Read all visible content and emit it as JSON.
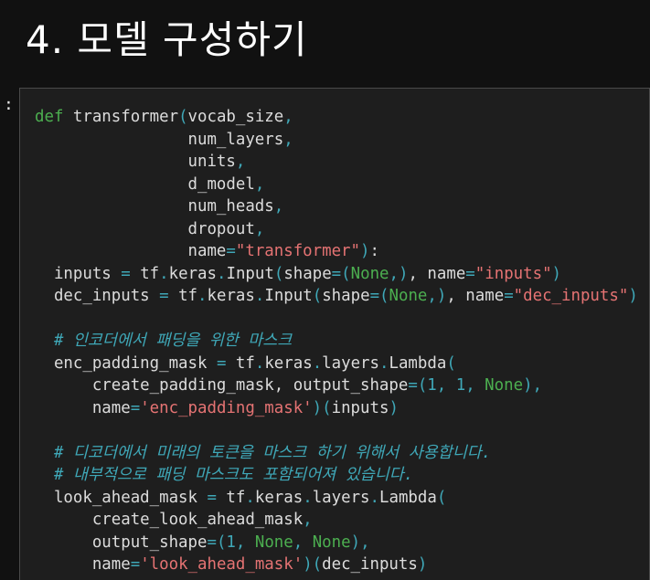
{
  "section": {
    "title": "4. 모델 구성하기"
  },
  "cell": {
    "prompt": ":",
    "lines": [
      [
        [
          "kw",
          "def"
        ],
        [
          "plain",
          " transformer"
        ],
        [
          "op",
          "("
        ],
        [
          "plain",
          "vocab_size"
        ],
        [
          "op",
          ","
        ]
      ],
      [
        [
          "plain",
          "                num_layers"
        ],
        [
          "op",
          ","
        ]
      ],
      [
        [
          "plain",
          "                units"
        ],
        [
          "op",
          ","
        ]
      ],
      [
        [
          "plain",
          "                d_model"
        ],
        [
          "op",
          ","
        ]
      ],
      [
        [
          "plain",
          "                num_heads"
        ],
        [
          "op",
          ","
        ]
      ],
      [
        [
          "plain",
          "                dropout"
        ],
        [
          "op",
          ","
        ]
      ],
      [
        [
          "plain",
          "                name"
        ],
        [
          "op",
          "="
        ],
        [
          "str",
          "\"transformer\""
        ],
        [
          "op",
          ")"
        ],
        [
          "plain",
          ":"
        ]
      ],
      [
        [
          "plain",
          "  inputs "
        ],
        [
          "op",
          "="
        ],
        [
          "plain",
          " tf"
        ],
        [
          "op",
          "."
        ],
        [
          "plain",
          "keras"
        ],
        [
          "op",
          "."
        ],
        [
          "plain",
          "Input"
        ],
        [
          "op",
          "("
        ],
        [
          "plain",
          "shape"
        ],
        [
          "op",
          "=("
        ],
        [
          "const",
          "None"
        ],
        [
          "op",
          ",)"
        ],
        [
          "plain",
          ", name"
        ],
        [
          "op",
          "="
        ],
        [
          "str",
          "\"inputs\""
        ],
        [
          "op",
          ")"
        ]
      ],
      [
        [
          "plain",
          "  dec_inputs "
        ],
        [
          "op",
          "="
        ],
        [
          "plain",
          " tf"
        ],
        [
          "op",
          "."
        ],
        [
          "plain",
          "keras"
        ],
        [
          "op",
          "."
        ],
        [
          "plain",
          "Input"
        ],
        [
          "op",
          "("
        ],
        [
          "plain",
          "shape"
        ],
        [
          "op",
          "=("
        ],
        [
          "const",
          "None"
        ],
        [
          "op",
          ",)"
        ],
        [
          "plain",
          ", name"
        ],
        [
          "op",
          "="
        ],
        [
          "str",
          "\"dec_inputs\""
        ],
        [
          "op",
          ")"
        ]
      ],
      [
        [
          "plain",
          ""
        ]
      ],
      [
        [
          "cmt",
          "  # 인코더에서 패딩을 위한 마스크"
        ]
      ],
      [
        [
          "plain",
          "  enc_padding_mask "
        ],
        [
          "op",
          "="
        ],
        [
          "plain",
          " tf"
        ],
        [
          "op",
          "."
        ],
        [
          "plain",
          "keras"
        ],
        [
          "op",
          "."
        ],
        [
          "plain",
          "layers"
        ],
        [
          "op",
          "."
        ],
        [
          "plain",
          "Lambda"
        ],
        [
          "op",
          "("
        ]
      ],
      [
        [
          "plain",
          "      create_padding_mask, output_shape"
        ],
        [
          "op",
          "=("
        ],
        [
          "num",
          "1"
        ],
        [
          "op",
          ","
        ],
        [
          "num",
          " 1"
        ],
        [
          "op",
          ","
        ],
        [
          "const",
          " None"
        ],
        [
          "op",
          "),"
        ]
      ],
      [
        [
          "plain",
          "      name"
        ],
        [
          "op",
          "="
        ],
        [
          "str",
          "'enc_padding_mask'"
        ],
        [
          "op",
          ")("
        ],
        [
          "plain",
          "inputs"
        ],
        [
          "op",
          ")"
        ]
      ],
      [
        [
          "plain",
          ""
        ]
      ],
      [
        [
          "cmt",
          "  # 디코더에서 미래의 토큰을 마스크 하기 위해서 사용합니다."
        ]
      ],
      [
        [
          "cmt",
          "  # 내부적으로 패딩 마스크도 포함되어져 있습니다."
        ]
      ],
      [
        [
          "plain",
          "  look_ahead_mask "
        ],
        [
          "op",
          "="
        ],
        [
          "plain",
          " tf"
        ],
        [
          "op",
          "."
        ],
        [
          "plain",
          "keras"
        ],
        [
          "op",
          "."
        ],
        [
          "plain",
          "layers"
        ],
        [
          "op",
          "."
        ],
        [
          "plain",
          "Lambda"
        ],
        [
          "op",
          "("
        ]
      ],
      [
        [
          "plain",
          "      create_look_ahead_mask"
        ],
        [
          "op",
          ","
        ]
      ],
      [
        [
          "plain",
          "      output_shape"
        ],
        [
          "op",
          "=("
        ],
        [
          "num",
          "1"
        ],
        [
          "op",
          ","
        ],
        [
          "const",
          " None"
        ],
        [
          "op",
          ","
        ],
        [
          "const",
          " None"
        ],
        [
          "op",
          "),"
        ]
      ],
      [
        [
          "plain",
          "      name"
        ],
        [
          "op",
          "="
        ],
        [
          "str",
          "'look_ahead_mask'"
        ],
        [
          "op",
          ")("
        ],
        [
          "plain",
          "dec_inputs"
        ],
        [
          "op",
          ")"
        ]
      ]
    ]
  }
}
